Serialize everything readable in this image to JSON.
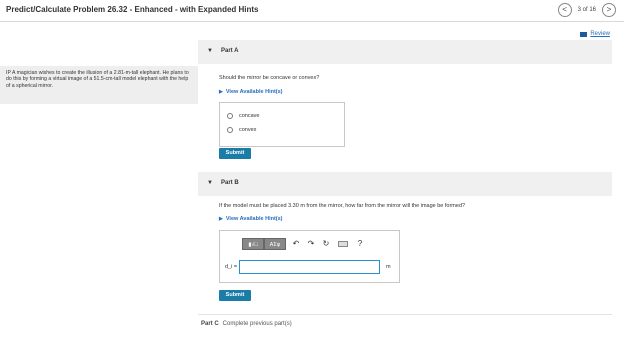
{
  "header": {
    "title": "Predict/Calculate Problem 26.32 - Enhanced - with Expanded Hints",
    "prev_label": "<",
    "next_label": ">",
    "page_count": "3 of 16"
  },
  "review_label": "Review",
  "problem": {
    "text": "IP A magician wishes to create the illusion of a 2.81-m-tall elephant. He plans to do this by forming a virtual image of a 51.5-cm-tall model elephant with the help of a spherical mirror."
  },
  "part_a": {
    "label": "Part A",
    "question": "Should the mirror be concave or convex?",
    "hint_label": "View Available Hint(s)",
    "options": [
      "concave",
      "convex"
    ],
    "submit_label": "Submit"
  },
  "part_b": {
    "label": "Part B",
    "question": "If the model must be placed 3.30 m from the mirror, how far from the mirror will the image be formed?",
    "hint_label": "View Available Hint(s)",
    "toolbar": {
      "template_label": "▮√□",
      "greek_label": "ΑΣφ",
      "help_label": "?"
    },
    "variable_label": "d_i =",
    "input_value": "",
    "unit_label": "m",
    "submit_label": "Submit"
  },
  "part_c": {
    "label": "Part C",
    "text": "Complete previous part(s)"
  },
  "colors": {
    "accent": "#1a7ca7",
    "link": "#2a6ebb",
    "panel": "#f0f0f0"
  }
}
